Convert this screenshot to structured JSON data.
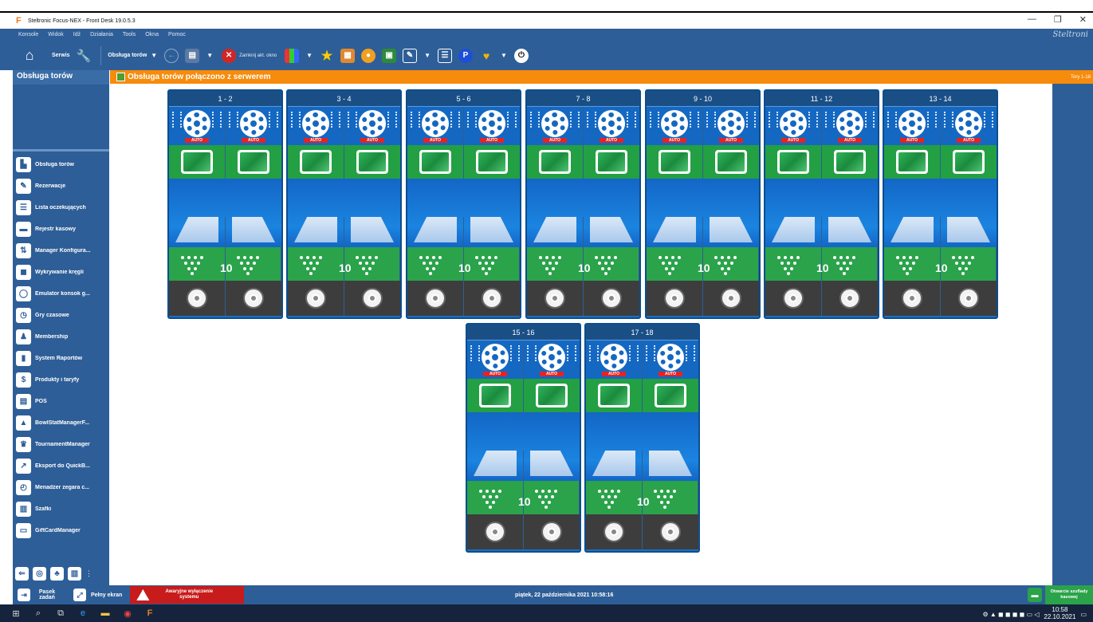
{
  "window": {
    "title": "Steltronic Focus-NEX - Front Desk 19.0.5.3",
    "brand": "Steltroni"
  },
  "menu": [
    "Konsole",
    "Widok",
    "Idź",
    "Działania",
    "Tools",
    "Okna",
    "Pomoc"
  ],
  "toolbar": {
    "serwis_label": "Serwis",
    "obsluga_label": "Obsługa torów",
    "close_window_label": "Zamknij akt. okno"
  },
  "sidebar": {
    "header": "Obsługa torów",
    "items": [
      {
        "label": "Obsługa torów",
        "icon": "lanes-icon"
      },
      {
        "label": "Rezerwacje",
        "icon": "edit-icon"
      },
      {
        "label": "Lista oczekujących",
        "icon": "list-icon"
      },
      {
        "label": "Rejestr kasowy",
        "icon": "register-icon"
      },
      {
        "label": "Manager Konfigura...",
        "icon": "sliders-icon"
      },
      {
        "label": "Wykrywanie kręgli",
        "icon": "camera-icon"
      },
      {
        "label": "Emulator konsok g...",
        "icon": "emulator-icon"
      },
      {
        "label": "Gry czasowe",
        "icon": "timer-icon"
      },
      {
        "label": "Membership",
        "icon": "users-icon"
      },
      {
        "label": "System Raportów",
        "icon": "chart-icon"
      },
      {
        "label": "Produkty i taryfy",
        "icon": "dollar-icon"
      },
      {
        "label": "POS",
        "icon": "pos-icon"
      },
      {
        "label": "BowlStatManagerF...",
        "icon": "stats-icon"
      },
      {
        "label": "TournamentManager",
        "icon": "trophy-icon"
      },
      {
        "label": "Eksport do QuickB...",
        "icon": "export-icon"
      },
      {
        "label": "Menadżer zegara c...",
        "icon": "clock-icon"
      },
      {
        "label": "Szafki",
        "icon": "lockers-icon"
      },
      {
        "label": "GiftCardManager",
        "icon": "giftcard-icon"
      }
    ]
  },
  "status": {
    "message": "Obsługa torów połączono z serwerem",
    "range": "Tory 1-18"
  },
  "lanes": [
    {
      "label": "1 - 2",
      "auto": "AUTO",
      "frame": "10"
    },
    {
      "label": "3 - 4",
      "auto": "AUTO",
      "frame": "10"
    },
    {
      "label": "5 - 6",
      "auto": "AUTO",
      "frame": "10"
    },
    {
      "label": "7 - 8",
      "auto": "AUTO",
      "frame": "10"
    },
    {
      "label": "9 - 10",
      "auto": "AUTO",
      "frame": "10"
    },
    {
      "label": "11 - 12",
      "auto": "AUTO",
      "frame": "10"
    },
    {
      "label": "13 - 14",
      "auto": "AUTO",
      "frame": "10"
    },
    {
      "label": "15 - 16",
      "auto": "AUTO",
      "frame": "10"
    },
    {
      "label": "17 - 18",
      "auto": "AUTO",
      "frame": "10"
    }
  ],
  "bottom": {
    "taskbar_label": "Pasek zadań",
    "fullscreen_label": "Pełny ekran",
    "emergency_label": "Awaryjne wyłączenie systemu",
    "datetime": "piątek, 22 października 2021 10:58:16",
    "cash_drawer_label": "Otwarcie szuflady kasowej"
  },
  "tray": {
    "time": "10:58",
    "date": "22.10.2021"
  },
  "colors": {
    "app_blue": "#2e5e97",
    "status_orange": "#f68b0c",
    "lane_blue": "#1c6fc0",
    "green": "#2aa34a",
    "alarm_red": "#c81b1b"
  }
}
